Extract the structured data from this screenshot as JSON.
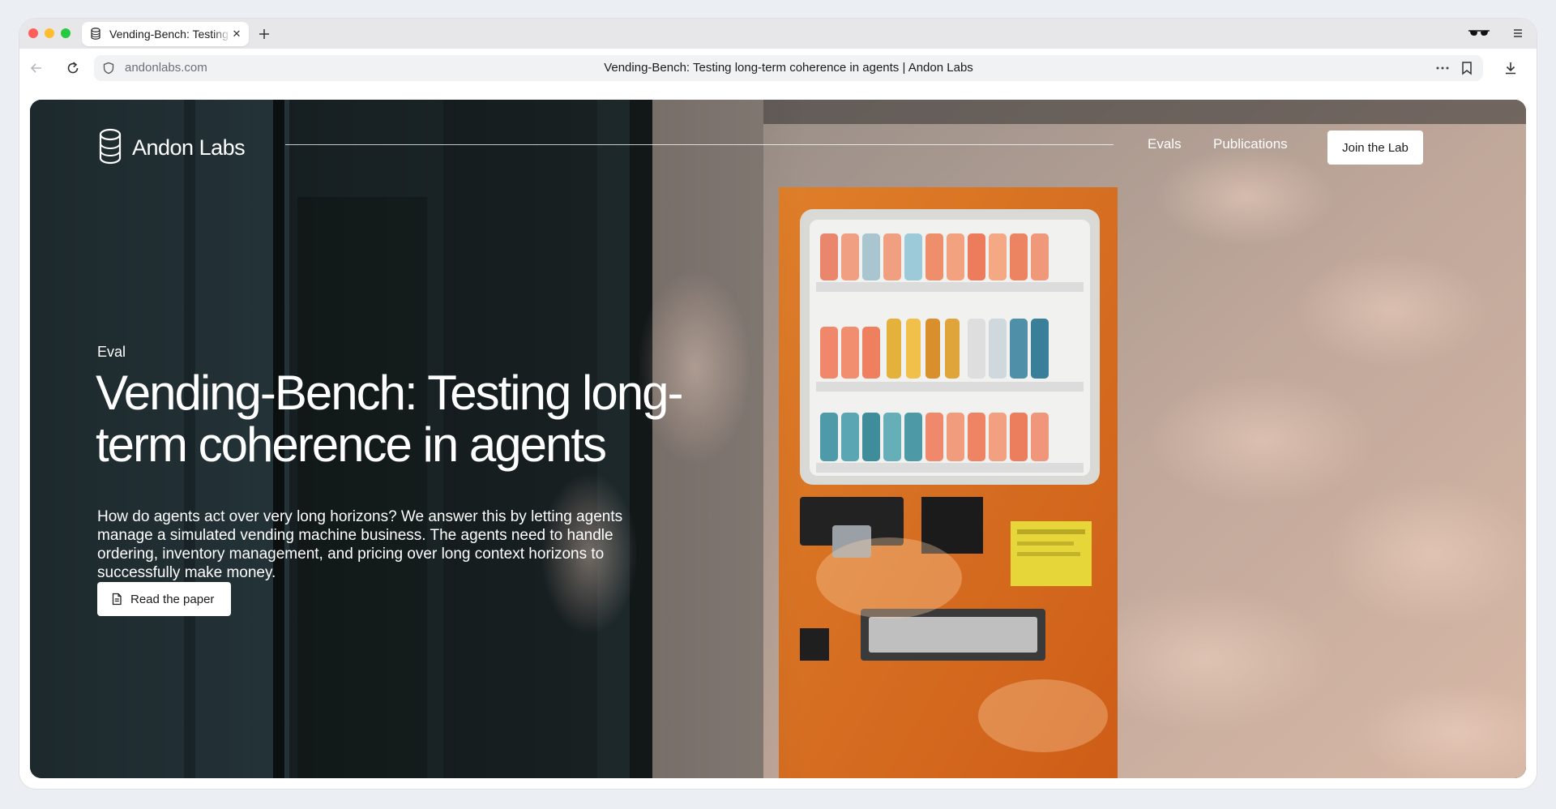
{
  "browser": {
    "tab_title": "Vending-Bench: Testing long-term coherence in agents | Andon Labs",
    "url_domain": "andonlabs.com",
    "page_title": "Vending-Bench: Testing long-term coherence in agents | Andon Labs"
  },
  "nav": {
    "logo_text": "Andon Labs",
    "links": [
      "Evals",
      "Publications"
    ],
    "cta_label": "Join the Lab"
  },
  "hero": {
    "tag": "Eval",
    "title": "Vending-Bench: Testing long-term coherence in agents",
    "description": "How do agents act over very long horizons? We answer this by letting agents manage a simulated vending machine business. The agents need to handle ordering, inventory management, and pricing over long context horizons to successfully make money.",
    "button_label": "Read the paper"
  },
  "colors": {
    "machine_orange": "#f07a1c",
    "wall_teal": "#2c3b40",
    "button_bg": "#ffffff"
  }
}
